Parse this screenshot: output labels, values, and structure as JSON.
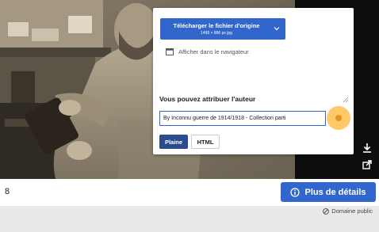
{
  "download_panel": {
    "download_label": "Télécharger le fichier d'origine",
    "download_size": "1499 × 896 px jpg",
    "browser_link": "Afficher dans le navigateur",
    "attribution_heading": "Vous pouvez attribuer l'auteur",
    "attribution_value": "By Inconnu guerre de 1914/1918 - Collection parti",
    "tab_plain": "Plaine",
    "tab_html": "HTML"
  },
  "bottom_bar": {
    "image_counter": "8",
    "more_details_label": "Plus de détails"
  },
  "license": {
    "label": "Domaine public"
  },
  "colors": {
    "accent": "#3366cc",
    "accent_dark": "#2a4b8d",
    "highlight": "#ffb736"
  },
  "icons": [
    "download-icon",
    "share-icon",
    "browser-window-icon",
    "chevron-down-icon",
    "info-icon",
    "public-domain-icon"
  ]
}
